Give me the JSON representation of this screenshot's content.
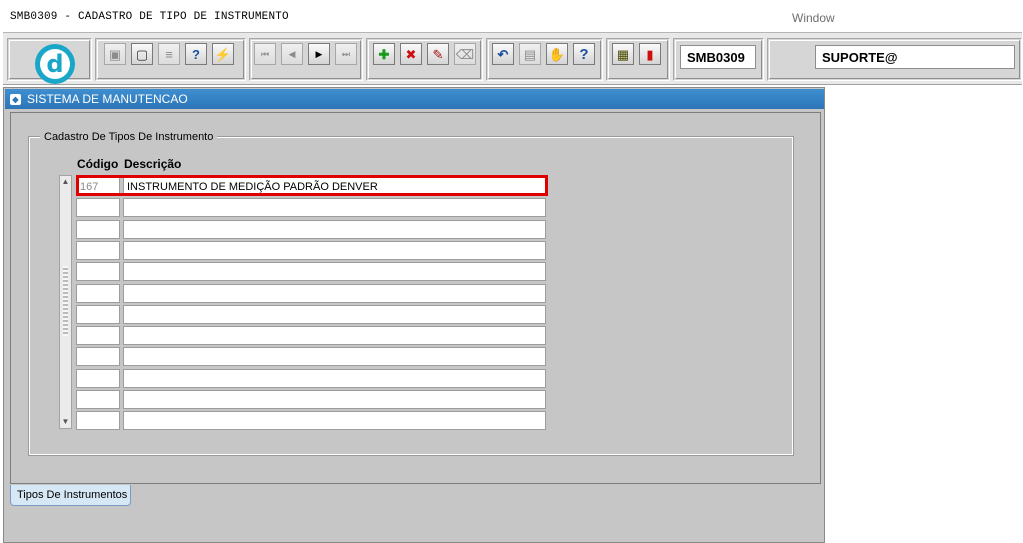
{
  "window": {
    "title": "SMB0309 - CADASTRO DE TIPO DE INSTRUMENTO",
    "menu_window": "Window"
  },
  "toolbar": {
    "logo_letter": "d",
    "buttons": [
      {
        "icon": "save-icon",
        "glyph": "▣"
      },
      {
        "icon": "print-preview-icon",
        "glyph": "▢"
      },
      {
        "icon": "print-icon",
        "glyph": "≡"
      },
      {
        "icon": "query-help-icon",
        "glyph": "?"
      },
      {
        "icon": "execute-query-icon",
        "glyph": "⚡"
      },
      {
        "icon": "first-record-icon",
        "glyph": "⏮"
      },
      {
        "icon": "previous-record-icon",
        "glyph": "◀"
      },
      {
        "icon": "next-record-icon",
        "glyph": "▶"
      },
      {
        "icon": "last-record-icon",
        "glyph": "⏭"
      },
      {
        "icon": "insert-record-icon",
        "glyph": "✚"
      },
      {
        "icon": "delete-record-icon",
        "glyph": "✖"
      },
      {
        "icon": "edit-record-icon",
        "glyph": "✎"
      },
      {
        "icon": "clear-icon",
        "glyph": "⌫"
      },
      {
        "icon": "undo-icon",
        "glyph": "↶"
      },
      {
        "icon": "clipboard-icon",
        "glyph": "▤"
      },
      {
        "icon": "tools-icon",
        "glyph": "✋"
      },
      {
        "icon": "help-icon",
        "glyph": "?"
      },
      {
        "icon": "menu-icon",
        "glyph": "▦"
      },
      {
        "icon": "exit-icon",
        "glyph": "▮"
      }
    ],
    "program_code": "SMB0309",
    "user": "SUPORTE@"
  },
  "panel": {
    "title": "SISTEMA DE MANUTENCAO",
    "group_label": "Cadastro De Tipos De Instrumento",
    "headers": {
      "code": "Código",
      "description": "Descrição"
    },
    "rows": [
      {
        "code": "167",
        "description": "INSTRUMENTO DE MEDIÇÃO PADRÃO DENVER"
      },
      {
        "code": "",
        "description": ""
      },
      {
        "code": "",
        "description": ""
      },
      {
        "code": "",
        "description": ""
      },
      {
        "code": "",
        "description": ""
      },
      {
        "code": "",
        "description": ""
      },
      {
        "code": "",
        "description": ""
      },
      {
        "code": "",
        "description": ""
      },
      {
        "code": "",
        "description": ""
      },
      {
        "code": "",
        "description": ""
      },
      {
        "code": "",
        "description": ""
      },
      {
        "code": "",
        "description": ""
      }
    ],
    "tab_label": "Tipos De Instrumentos"
  },
  "colors": {
    "title_bar_blue": "#2c75b8",
    "highlight_red": "#e00000",
    "logo_cyan": "#1aa6c8"
  }
}
